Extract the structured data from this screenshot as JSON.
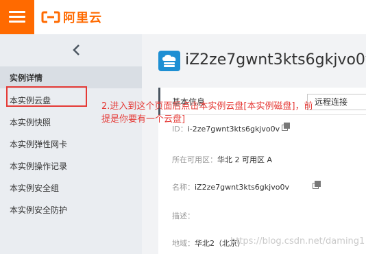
{
  "header": {
    "logo_text": "阿里云",
    "brand_color": "#ff6a00"
  },
  "sidebar": {
    "collapse_icon": "chevron-left-icon",
    "section_title": "实例详情",
    "items": [
      {
        "label": "本实例云盘"
      },
      {
        "label": "本实例快照"
      },
      {
        "label": "本实例弹性网卡"
      },
      {
        "label": "本实例操作记录"
      },
      {
        "label": "本实例安全组"
      },
      {
        "label": "本实例安全防护"
      }
    ]
  },
  "main": {
    "instance_title": "iZ2ze7gwnt3kts6gkjvo0v.",
    "basic_info": {
      "title": "基本信息",
      "remote_button": "远程连接",
      "rows": [
        {
          "label": "ID：",
          "value": "i-2ze7gwnt3kts6gkjvo0v"
        },
        {
          "label": "所在可用区：",
          "value": "华北 2 可用区 A"
        },
        {
          "label": "名称：",
          "value": "iZ2ze7gwnt3kts6gkjvo0v"
        },
        {
          "label": "描述：",
          "value": ""
        },
        {
          "label": "地域：",
          "value": "华北2（北京）"
        }
      ]
    }
  },
  "annotation": {
    "line1": "2.进入到这个页面后点击本实例云盘[本实例磁盘]，前",
    "line2": "提是你要有一个云盘]",
    "color": "#e53935"
  },
  "watermark": "https://blog.csdn.net/daming1"
}
